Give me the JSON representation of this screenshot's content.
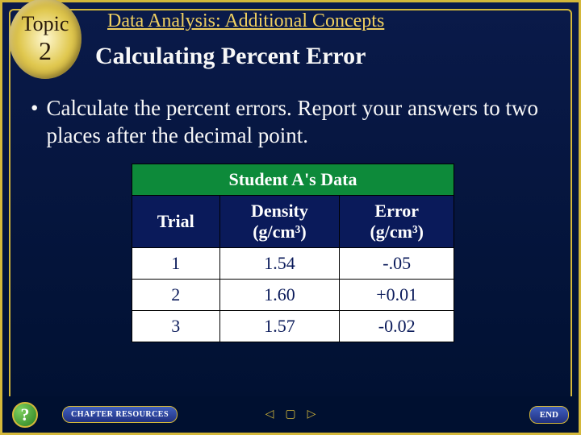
{
  "topic": {
    "label": "Topic",
    "number": "2"
  },
  "title": "Data Analysis: Additional Concepts",
  "heading": "Calculating Percent Error",
  "bullet": "Calculate the percent errors. Report your answers to two places after the decimal point.",
  "table": {
    "title": "Student A's Data",
    "cols": {
      "trial": "Trial",
      "density": "Density",
      "density_unit": "(g/cm³)",
      "error": "Error",
      "error_unit": "(g/cm³)"
    },
    "rows": [
      {
        "trial": "1",
        "density": "1.54",
        "error": "-.05"
      },
      {
        "trial": "2",
        "density": "1.60",
        "error": "+0.01"
      },
      {
        "trial": "3",
        "density": "1.57",
        "error": "-0.02"
      }
    ]
  },
  "footer": {
    "help": "?",
    "chapter": "CHAPTER RESOURCES",
    "end": "END"
  }
}
